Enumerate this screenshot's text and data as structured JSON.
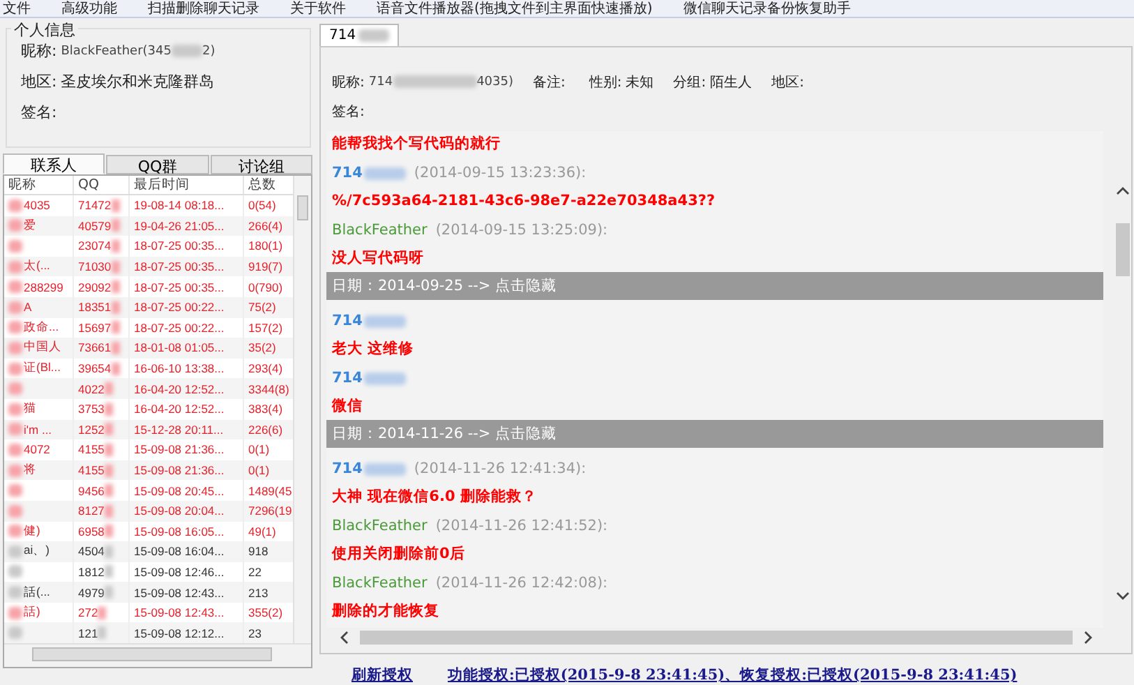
{
  "menu": [
    "文件",
    "高级功能",
    "扫描删除聊天记录",
    "关于软件",
    "语音文件播放器(拖拽文件到主界面快速播放)",
    "微信聊天记录备份恢复助手"
  ],
  "profile": {
    "title": "个人信息",
    "nickname_label": "昵称:",
    "nickname": "BlackFeather(345",
    "nickname_tail": "2)",
    "region_label": "地区:",
    "region": "圣皮埃尔和米克隆群岛",
    "signature_label": "签名:"
  },
  "list_tabs": [
    {
      "label": "联系人",
      "selected": true
    },
    {
      "label": "QQ群",
      "selected": false
    },
    {
      "label": "讨论组",
      "selected": false
    }
  ],
  "table": {
    "columns": [
      "昵称",
      "QQ",
      "最后时间",
      "总数"
    ],
    "rows": [
      {
        "name": "4035",
        "qq": "71472",
        "time": "19-08-14 08:18...",
        "total": "0(54)",
        "color": "#e8202a"
      },
      {
        "name": "爱",
        "qq": "40579",
        "time": "19-04-26 21:05...",
        "total": "266(4)",
        "color": "#e8202a"
      },
      {
        "name": "",
        "qq": "23074",
        "time": "18-07-25 00:35...",
        "total": "180(1)",
        "color": "#e8202a"
      },
      {
        "name": "太(...",
        "qq": "71030",
        "time": "18-07-25 00:35...",
        "total": "919(7)",
        "color": "#e8202a"
      },
      {
        "name": "288299",
        "qq": "29092",
        "time": "18-07-25 00:35...",
        "total": "0(790)",
        "color": "#e8202a"
      },
      {
        "name": "A",
        "qq": "18351",
        "time": "18-07-25 00:22...",
        "total": "75(2)",
        "color": "#e8202a"
      },
      {
        "name": "政命...",
        "qq": "15697",
        "time": "18-07-25 00:22...",
        "total": "157(2)",
        "color": "#e8202a"
      },
      {
        "name": "中国人",
        "qq": "73661",
        "time": "18-01-08 01:05...",
        "total": "35(2)",
        "color": "#e8202a"
      },
      {
        "name": "证(Bl...",
        "qq": "39654",
        "time": "16-06-10 13:38...",
        "total": "293(4)",
        "color": "#e8202a"
      },
      {
        "name": "",
        "qq": "4022",
        "time": "16-04-20 12:52...",
        "total": "3344(8)",
        "color": "#e8202a"
      },
      {
        "name": "猫",
        "qq": "3753",
        "time": "16-04-20 12:52...",
        "total": "383(4)",
        "color": "#e8202a"
      },
      {
        "name": "i'm ...",
        "qq": "1252",
        "time": "15-12-28 20:11...",
        "total": "226(6)",
        "color": "#e8202a"
      },
      {
        "name": "4072",
        "qq": "4155",
        "time": "15-09-08 21:36...",
        "total": "0(1)",
        "color": "#e8202a"
      },
      {
        "name": "将",
        "qq": "4155",
        "time": "15-09-08 21:36...",
        "total": "0(1)",
        "color": "#e8202a"
      },
      {
        "name": "",
        "qq": "9456",
        "time": "15-09-08 20:45...",
        "total": "1489(45",
        "color": "#e8202a"
      },
      {
        "name": "",
        "qq": "8127",
        "time": "15-09-08 20:04...",
        "total": "7296(19",
        "color": "#e8202a"
      },
      {
        "name": "健)",
        "qq": "6958",
        "time": "15-09-08 16:05...",
        "total": "49(1)",
        "color": "#e8202a"
      },
      {
        "name": "ai、)",
        "qq": "4504",
        "time": "15-09-08 16:04...",
        "total": "918",
        "color": "#333333"
      },
      {
        "name": "",
        "qq": "1812",
        "time": "15-09-08 12:46...",
        "total": "22",
        "color": "#333333"
      },
      {
        "name": "話(...",
        "qq": "4979",
        "time": "15-09-08 12:43...",
        "total": "213",
        "color": "#333333"
      },
      {
        "name": "話)",
        "qq": "272",
        "time": "15-09-08 12:43...",
        "total": "355(2)",
        "color": "#e8202a"
      },
      {
        "name": "",
        "qq": "121",
        "time": "15-09-08 12:12...",
        "total": "23",
        "color": "#333333"
      }
    ]
  },
  "chat_tab": {
    "label": "714",
    "selected": true
  },
  "contact": {
    "nickname_label": "昵称:",
    "nickname": "714",
    "nickname_tail": "4035)",
    "remark_label": "备注:",
    "gender_label": "性别:",
    "gender": "未知",
    "group_label": "分组:",
    "group": "陌生人",
    "region_label": "地区:",
    "signature_label": "签名:"
  },
  "chat": [
    {
      "kind": "text",
      "text": "能帮我找个写代码的就行"
    },
    {
      "kind": "message",
      "sender": "714",
      "self": false,
      "time": "(2014-09-15 13:23:36):",
      "text": "%/7c593a64-2181-43c6-98e7-a22e70348a43??"
    },
    {
      "kind": "message",
      "sender": "BlackFeather",
      "self": true,
      "time": "(2014-09-15 13:25:09):",
      "text": "没人写代码呀"
    },
    {
      "kind": "date",
      "text": "日期：2014-09-25  --> 点击隐藏"
    },
    {
      "kind": "message",
      "sender": "714",
      "self": false,
      "text": "老大 这维修"
    },
    {
      "kind": "message",
      "sender": "714",
      "self": false,
      "text": "微信"
    },
    {
      "kind": "date",
      "text": "日期：2014-11-26  --> 点击隐藏"
    },
    {
      "kind": "message",
      "sender": "714",
      "self": false,
      "time": "(2014-11-26 12:41:34):",
      "text": "大神 现在微信6.0 删除能救？"
    },
    {
      "kind": "message",
      "sender": "BlackFeather",
      "self": true,
      "time": "(2014-11-26 12:41:52):",
      "text": "使用关闭删除前0后"
    },
    {
      "kind": "message",
      "sender": "BlackFeather",
      "self": true,
      "time": "(2014-11-26 12:42:08):",
      "text": "删除的才能恢复"
    }
  ],
  "links": [
    "刷新授权",
    "功能授权:已授权(2015-9-8 23:41:45)、恢复授权:已授权(2015-9-8 23:41:45)"
  ]
}
